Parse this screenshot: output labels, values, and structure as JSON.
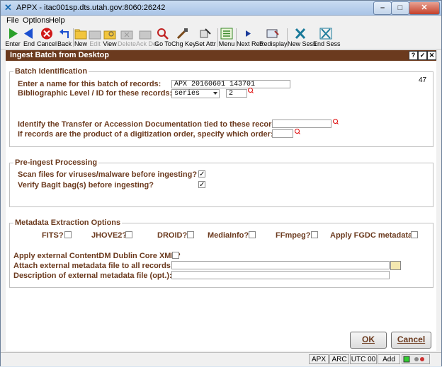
{
  "window": {
    "title": "APPX - itac001sp.dts.utah.gov:8060:26242",
    "min": "–",
    "max": "□",
    "close": "✕"
  },
  "menu": [
    "File",
    "Options",
    "Help"
  ],
  "toolbar": [
    {
      "label": "Enter",
      "icon": "enter-icon",
      "disabled": false
    },
    {
      "label": "End",
      "icon": "end-icon",
      "disabled": false
    },
    {
      "label": "Cancel",
      "icon": "cancel-icon",
      "disabled": false
    },
    {
      "label": "Back",
      "icon": "back-icon",
      "disabled": false
    },
    {
      "label": "New",
      "icon": "new-folder-icon",
      "disabled": false
    },
    {
      "label": "Edit",
      "icon": "edit-icon",
      "disabled": true
    },
    {
      "label": "View",
      "icon": "view-icon",
      "disabled": false
    },
    {
      "label": "Delete",
      "icon": "delete-icon",
      "disabled": true
    },
    {
      "label": "Ack Del",
      "icon": "ack-delete-icon",
      "disabled": true
    },
    {
      "label": "Go To",
      "icon": "goto-icon",
      "disabled": false
    },
    {
      "label": "Chg Key",
      "icon": "change-key-icon",
      "disabled": false
    },
    {
      "label": "Set Attr",
      "icon": "set-attr-icon",
      "disabled": false
    },
    {
      "label": "Menu",
      "icon": "menu-icon",
      "disabled": false
    },
    {
      "label": "Next Rec",
      "icon": "next-record-icon",
      "disabled": false
    },
    {
      "label": "Redisplay",
      "icon": "redisplay-icon",
      "disabled": false
    },
    {
      "label": "New Sess",
      "icon": "new-session-icon",
      "disabled": false
    },
    {
      "label": "End Sess",
      "icon": "end-session-icon",
      "disabled": false
    }
  ],
  "dialog": {
    "title": "Ingest Batch from Desktop",
    "help": "?",
    "check": "✓",
    "close": "✕"
  },
  "batch": {
    "legend": "Batch Identification",
    "count": "47",
    "name_label": "Enter a name for this batch of records:",
    "name_value": "APX 20160601 143701",
    "level_label": "Bibliographic Level / ID for these records:",
    "level_value": "series",
    "id_value": "2",
    "transfer_label": "Identify the Transfer or Accession Documentation tied to these records:",
    "transfer_value": "",
    "digitization_label": "If records are the product of a digitization order, specify which order:",
    "digitization_value": ""
  },
  "preingest": {
    "legend": "Pre-ingest Processing",
    "scan_label": "Scan files for viruses/malware before ingesting?",
    "scan_checked": "✓",
    "bagit_label": "Verify BagIt bag(s) before ingesting?",
    "bagit_checked": "✓"
  },
  "metadata": {
    "legend": "Metadata Extraction Options",
    "fits": "FITS?",
    "jhove": "JHOVE2?",
    "droid": "DROID?",
    "mediainfo": "MediaInfo?",
    "ffmpeg": "FFmpeg?",
    "fgdc": "Apply FGDC metadata?",
    "contentdm_label": "Apply external ContentDM Dublin Core XML?",
    "attach_label": "Attach external metadata file to all records:",
    "attach_value": "",
    "desc_label": "Description of external metadata file (opt.):",
    "desc_value": ""
  },
  "buttons": {
    "ok": "OK",
    "cancel": "Cancel"
  },
  "status": {
    "apx": "APX",
    "arc": "ARC",
    "utc": "UTC 00",
    "mode": "Add"
  }
}
